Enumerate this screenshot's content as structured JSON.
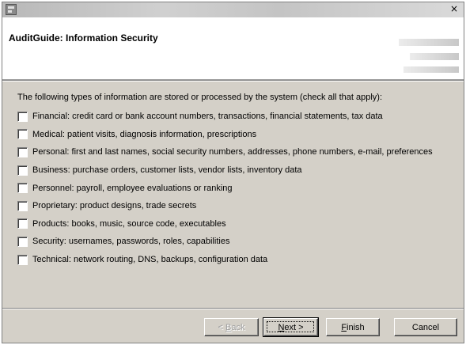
{
  "window": {
    "title": "",
    "close_glyph": "×",
    "app_icon": "eclipse-app-icon"
  },
  "banner": {
    "title": "AuditGuide: Information Security"
  },
  "content": {
    "instruction": "The following types of information are stored or processed by the system (check all that apply):",
    "options": [
      {
        "label": "Financial: credit card or bank account numbers, transactions, financial statements, tax data",
        "checked": false
      },
      {
        "label": "Medical: patient visits, diagnosis information, prescriptions",
        "checked": false
      },
      {
        "label": "Personal: first and last names, social security numbers, addresses, phone numbers, e-mail, preferences",
        "checked": false
      },
      {
        "label": "Business: purchase orders, customer lists, vendor lists, inventory data",
        "checked": false
      },
      {
        "label": "Personnel: payroll, employee evaluations or ranking",
        "checked": false
      },
      {
        "label": "Proprietary: product designs, trade secrets",
        "checked": false
      },
      {
        "label": "Products: books, music, source code, executables",
        "checked": false
      },
      {
        "label": "Security: usernames, passwords, roles, capabilities",
        "checked": false
      },
      {
        "label": "Technical: network routing, DNS, backups, configuration data",
        "checked": false
      }
    ]
  },
  "buttons": {
    "back": {
      "prefix": "< ",
      "accel": "B",
      "rest": "ack",
      "enabled": false
    },
    "next": {
      "accel": "N",
      "rest": "ext >",
      "enabled": true
    },
    "finish": {
      "accel": "F",
      "rest": "inish",
      "enabled": true
    },
    "cancel": {
      "label": "Cancel",
      "enabled": true
    }
  },
  "colors": {
    "dialog_face": "#d4d0c8",
    "banner_bg": "#ffffff",
    "disabled_text": "#a0a0a0"
  }
}
